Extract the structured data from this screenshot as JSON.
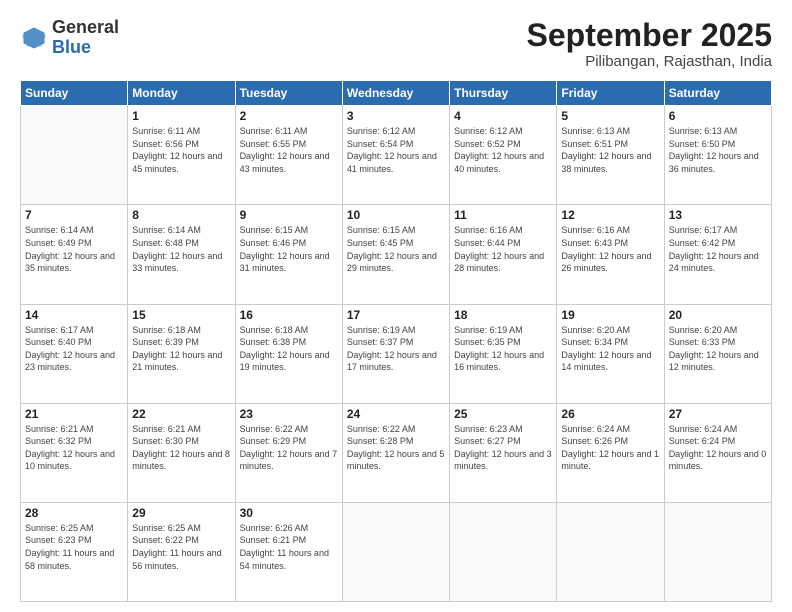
{
  "header": {
    "logo_general": "General",
    "logo_blue": "Blue",
    "month_title": "September 2025",
    "subtitle": "Pilibangan, Rajasthan, India"
  },
  "weekdays": [
    "Sunday",
    "Monday",
    "Tuesday",
    "Wednesday",
    "Thursday",
    "Friday",
    "Saturday"
  ],
  "weeks": [
    [
      {
        "day": "",
        "sunrise": "",
        "sunset": "",
        "daylight": ""
      },
      {
        "day": "1",
        "sunrise": "Sunrise: 6:11 AM",
        "sunset": "Sunset: 6:56 PM",
        "daylight": "Daylight: 12 hours and 45 minutes."
      },
      {
        "day": "2",
        "sunrise": "Sunrise: 6:11 AM",
        "sunset": "Sunset: 6:55 PM",
        "daylight": "Daylight: 12 hours and 43 minutes."
      },
      {
        "day": "3",
        "sunrise": "Sunrise: 6:12 AM",
        "sunset": "Sunset: 6:54 PM",
        "daylight": "Daylight: 12 hours and 41 minutes."
      },
      {
        "day": "4",
        "sunrise": "Sunrise: 6:12 AM",
        "sunset": "Sunset: 6:52 PM",
        "daylight": "Daylight: 12 hours and 40 minutes."
      },
      {
        "day": "5",
        "sunrise": "Sunrise: 6:13 AM",
        "sunset": "Sunset: 6:51 PM",
        "daylight": "Daylight: 12 hours and 38 minutes."
      },
      {
        "day": "6",
        "sunrise": "Sunrise: 6:13 AM",
        "sunset": "Sunset: 6:50 PM",
        "daylight": "Daylight: 12 hours and 36 minutes."
      }
    ],
    [
      {
        "day": "7",
        "sunrise": "Sunrise: 6:14 AM",
        "sunset": "Sunset: 6:49 PM",
        "daylight": "Daylight: 12 hours and 35 minutes."
      },
      {
        "day": "8",
        "sunrise": "Sunrise: 6:14 AM",
        "sunset": "Sunset: 6:48 PM",
        "daylight": "Daylight: 12 hours and 33 minutes."
      },
      {
        "day": "9",
        "sunrise": "Sunrise: 6:15 AM",
        "sunset": "Sunset: 6:46 PM",
        "daylight": "Daylight: 12 hours and 31 minutes."
      },
      {
        "day": "10",
        "sunrise": "Sunrise: 6:15 AM",
        "sunset": "Sunset: 6:45 PM",
        "daylight": "Daylight: 12 hours and 29 minutes."
      },
      {
        "day": "11",
        "sunrise": "Sunrise: 6:16 AM",
        "sunset": "Sunset: 6:44 PM",
        "daylight": "Daylight: 12 hours and 28 minutes."
      },
      {
        "day": "12",
        "sunrise": "Sunrise: 6:16 AM",
        "sunset": "Sunset: 6:43 PM",
        "daylight": "Daylight: 12 hours and 26 minutes."
      },
      {
        "day": "13",
        "sunrise": "Sunrise: 6:17 AM",
        "sunset": "Sunset: 6:42 PM",
        "daylight": "Daylight: 12 hours and 24 minutes."
      }
    ],
    [
      {
        "day": "14",
        "sunrise": "Sunrise: 6:17 AM",
        "sunset": "Sunset: 6:40 PM",
        "daylight": "Daylight: 12 hours and 23 minutes."
      },
      {
        "day": "15",
        "sunrise": "Sunrise: 6:18 AM",
        "sunset": "Sunset: 6:39 PM",
        "daylight": "Daylight: 12 hours and 21 minutes."
      },
      {
        "day": "16",
        "sunrise": "Sunrise: 6:18 AM",
        "sunset": "Sunset: 6:38 PM",
        "daylight": "Daylight: 12 hours and 19 minutes."
      },
      {
        "day": "17",
        "sunrise": "Sunrise: 6:19 AM",
        "sunset": "Sunset: 6:37 PM",
        "daylight": "Daylight: 12 hours and 17 minutes."
      },
      {
        "day": "18",
        "sunrise": "Sunrise: 6:19 AM",
        "sunset": "Sunset: 6:35 PM",
        "daylight": "Daylight: 12 hours and 16 minutes."
      },
      {
        "day": "19",
        "sunrise": "Sunrise: 6:20 AM",
        "sunset": "Sunset: 6:34 PM",
        "daylight": "Daylight: 12 hours and 14 minutes."
      },
      {
        "day": "20",
        "sunrise": "Sunrise: 6:20 AM",
        "sunset": "Sunset: 6:33 PM",
        "daylight": "Daylight: 12 hours and 12 minutes."
      }
    ],
    [
      {
        "day": "21",
        "sunrise": "Sunrise: 6:21 AM",
        "sunset": "Sunset: 6:32 PM",
        "daylight": "Daylight: 12 hours and 10 minutes."
      },
      {
        "day": "22",
        "sunrise": "Sunrise: 6:21 AM",
        "sunset": "Sunset: 6:30 PM",
        "daylight": "Daylight: 12 hours and 8 minutes."
      },
      {
        "day": "23",
        "sunrise": "Sunrise: 6:22 AM",
        "sunset": "Sunset: 6:29 PM",
        "daylight": "Daylight: 12 hours and 7 minutes."
      },
      {
        "day": "24",
        "sunrise": "Sunrise: 6:22 AM",
        "sunset": "Sunset: 6:28 PM",
        "daylight": "Daylight: 12 hours and 5 minutes."
      },
      {
        "day": "25",
        "sunrise": "Sunrise: 6:23 AM",
        "sunset": "Sunset: 6:27 PM",
        "daylight": "Daylight: 12 hours and 3 minutes."
      },
      {
        "day": "26",
        "sunrise": "Sunrise: 6:24 AM",
        "sunset": "Sunset: 6:26 PM",
        "daylight": "Daylight: 12 hours and 1 minute."
      },
      {
        "day": "27",
        "sunrise": "Sunrise: 6:24 AM",
        "sunset": "Sunset: 6:24 PM",
        "daylight": "Daylight: 12 hours and 0 minutes."
      }
    ],
    [
      {
        "day": "28",
        "sunrise": "Sunrise: 6:25 AM",
        "sunset": "Sunset: 6:23 PM",
        "daylight": "Daylight: 11 hours and 58 minutes."
      },
      {
        "day": "29",
        "sunrise": "Sunrise: 6:25 AM",
        "sunset": "Sunset: 6:22 PM",
        "daylight": "Daylight: 11 hours and 56 minutes."
      },
      {
        "day": "30",
        "sunrise": "Sunrise: 6:26 AM",
        "sunset": "Sunset: 6:21 PM",
        "daylight": "Daylight: 11 hours and 54 minutes."
      },
      {
        "day": "",
        "sunrise": "",
        "sunset": "",
        "daylight": ""
      },
      {
        "day": "",
        "sunrise": "",
        "sunset": "",
        "daylight": ""
      },
      {
        "day": "",
        "sunrise": "",
        "sunset": "",
        "daylight": ""
      },
      {
        "day": "",
        "sunrise": "",
        "sunset": "",
        "daylight": ""
      }
    ]
  ]
}
